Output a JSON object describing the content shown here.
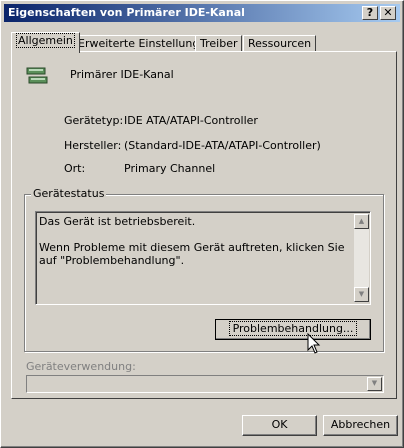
{
  "window": {
    "title": "Eigenschaften von Primärer IDE-Kanal",
    "help_label": "?",
    "close_label": "✕"
  },
  "tabs": [
    {
      "label": "Allgemein",
      "active": true
    },
    {
      "label": "Erweiterte Einstellungen",
      "active": false
    },
    {
      "label": "Treiber",
      "active": false
    },
    {
      "label": "Ressourcen",
      "active": false
    }
  ],
  "device": {
    "icon": "ide-controller-icon",
    "name": "Primärer IDE-Kanal"
  },
  "properties": [
    {
      "label": "Gerätetyp:",
      "value": "IDE ATA/ATAPI-Controller"
    },
    {
      "label": "Hersteller:",
      "value": "(Standard-IDE-ATA/ATAPI-Controller)"
    },
    {
      "label": "Ort:",
      "value": "Primary Channel"
    }
  ],
  "status_group": {
    "legend": "Gerätestatus",
    "line1": "Das Gerät ist betriebsbereit.",
    "line2": "Wenn Probleme mit diesem Gerät auftreten, klicken Sie auf \"Problembehandlung\".",
    "button_label": "Problembehandlung..."
  },
  "usage": {
    "label": "Geräteverwendung:",
    "value": ""
  },
  "buttons": {
    "ok": "OK",
    "cancel": "Abbrechen"
  }
}
